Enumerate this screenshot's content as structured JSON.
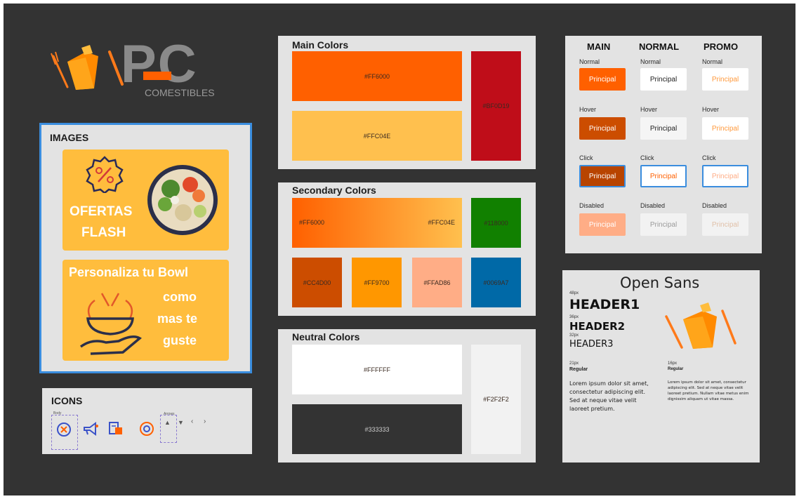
{
  "logo": {
    "letters": "PC",
    "subtitle": "COMESTIBLES"
  },
  "images": {
    "title": "IMAGES",
    "card1": {
      "line1": "OFERTAS",
      "line2": "FLASH"
    },
    "card2": {
      "title": "Personaliza tu Bowl",
      "line1": "como",
      "line2": "mas te",
      "line3": "guste"
    }
  },
  "icons": {
    "title": "ICONS",
    "tag_body": "Body",
    "tag_arrows": "Arrows"
  },
  "main_colors": {
    "title": "Main Colors",
    "swatches": [
      "#FF6000",
      "#FFC04E",
      "#BF0D19"
    ]
  },
  "secondary_colors": {
    "title": "Secondary Colors",
    "gradient_start": "#FF6000",
    "gradient_end": "#FFC04E",
    "swatches": [
      "#118000",
      "#CC4D00",
      "#FF9700",
      "#FFAD86",
      "#0069A7"
    ]
  },
  "neutral_colors": {
    "title": "Neutral Colors",
    "swatches": [
      "#FFFFFF",
      "#333333",
      "#F2F2F2"
    ]
  },
  "buttons": {
    "columns": [
      "MAIN",
      "NORMAL",
      "PROMO"
    ],
    "states": [
      "Normal",
      "Hover",
      "Click",
      "Disabled"
    ],
    "label": "Principal"
  },
  "typography": {
    "font_name": "Open Sans",
    "h1_size": "48px",
    "h1": "HEADER1",
    "h2_size": "36px",
    "h2": "HEADER2",
    "h3_size": "32px",
    "h3": "HEADER3",
    "body1_size": "21px",
    "body1_weight": "Regular",
    "body1_text": "Lorem ipsum dolor sit amet, consectetur adipiscing elit. Sed at neque vitae velit laoreet pretium.",
    "body2_size": "16px",
    "body2_weight": "Regular",
    "body2_text": "Lorem ipsum dolor sit amet, consectetur adipiscing elit. Sed at neque vitae velit laoreet pretium. Nullam vitae metus enim dignissim aliquam ut vitae massa."
  },
  "colors": {
    "canvas": "#333333",
    "panel": "#E3E3E3",
    "orange": "#FF6000",
    "yellow": "#FFC04E",
    "accent_blue": "#3A8DDE"
  }
}
